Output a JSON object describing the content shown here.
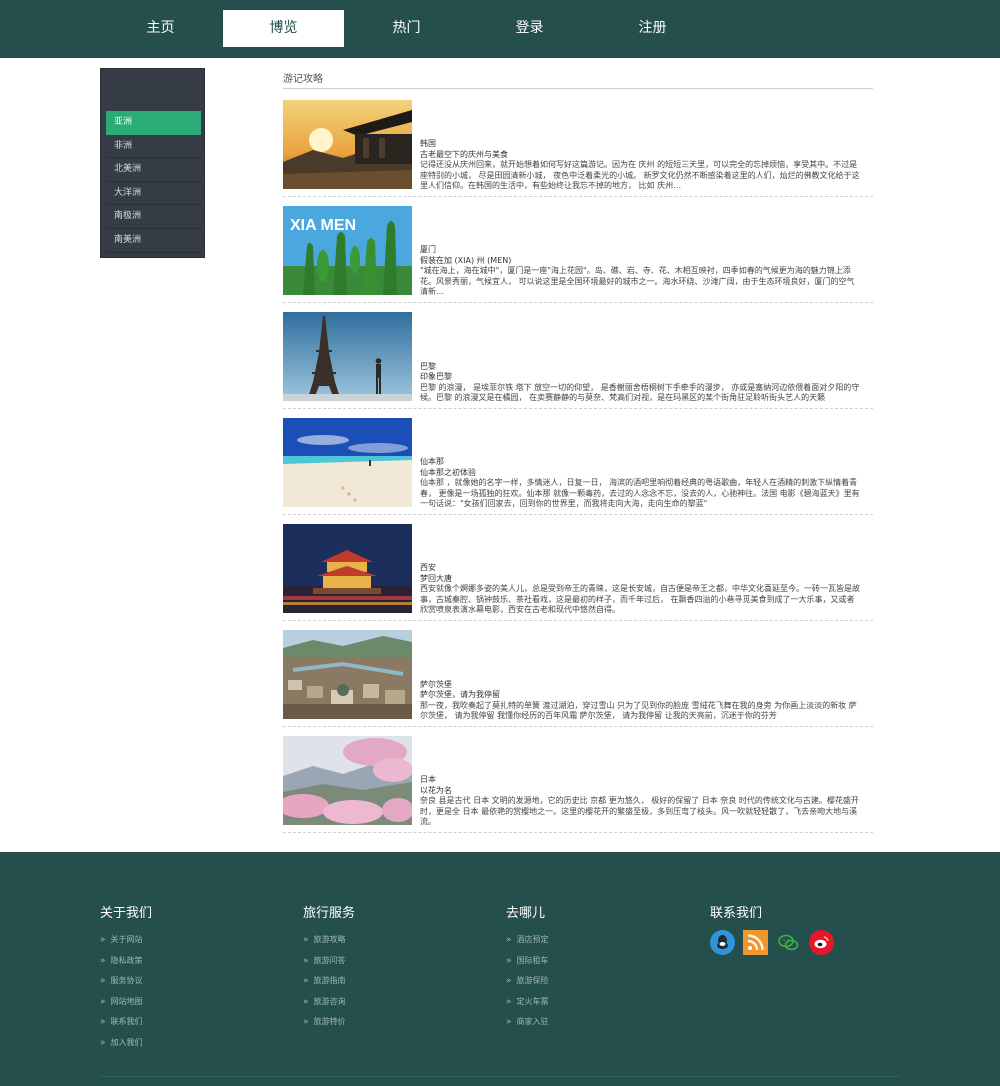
{
  "nav": {
    "items": [
      {
        "label": "主页",
        "active": false
      },
      {
        "label": "博览",
        "active": true
      },
      {
        "label": "热门",
        "active": false
      },
      {
        "label": "登录",
        "active": false
      },
      {
        "label": "注册",
        "active": false
      }
    ]
  },
  "sidebar": {
    "items": [
      {
        "label": "亚洲",
        "active": true
      },
      {
        "label": "非洲",
        "active": false
      },
      {
        "label": "北美洲",
        "active": false
      },
      {
        "label": "大洋洲",
        "active": false
      },
      {
        "label": "南极洲",
        "active": false
      },
      {
        "label": "南美洲",
        "active": false
      }
    ]
  },
  "main": {
    "section_title": "游记攻略",
    "articles": [
      {
        "location": "韩国",
        "subtitle": "古老最空下的庆州与美食",
        "description": "记得还没从庆州回来，就开始想着如何写好这篇游记。因为在 庆州 的短短三天里，可以完全的忘掉烦恼，享受其中。不过是座特别的小城， 尽是田园清新小城， 夜色中泛着柔光的小城。 新罗文化仍然不断感染着这里的人们，灿烂的佛教文化给于这里人们信仰。在韩国的生活中，有些始终让我忘不掉的地方， 比如 庆州…",
        "image_text": ""
      },
      {
        "location": "厦门",
        "subtitle": "假装在加 (XIA) 州 (MEN)",
        "description": "\"城在海上，海在城中\"，厦门是一座\"海上花园\"。岛、礁、岩、寺、花、木相互映衬，四季如春的气候更为海的魅力锦上添花。风景秀丽，气候宜人， 可以说这里是全国环境最好的城市之一。海水环绕、沙滩广阔，由于生态环境良好，厦门的空气清新…",
        "image_text": "XIA MEN"
      },
      {
        "location": "巴黎",
        "subtitle": "印象巴黎",
        "description": "巴黎 的浪漫， 是埃菲尔铁 塔下 放空一切的仰望， 是香榭丽舍梧桐树下手牵手的漫步， 亦或是塞纳河边依偎着面对夕阳的守候。巴黎 的浪漫又是在橘园， 在卖赛静静的与莫奈、梵高们对视，是在玛黑区的某个街角驻足聆听街头艺人的天籁",
        "image_text": ""
      },
      {
        "location": "仙本那",
        "subtitle": "仙本那之初体验",
        "description": "仙本那 ，就像她的名字一样，多情迷人，日复一日， 海滨的酒吧里响彻着经典的粤语歌曲，年轻人在酒精的刺激下纵情着青春， 更像是一场孤独的狂欢。仙本那 就像一颗毒药，去过的人念念不忘，没去的人，心驰神往。法国 电影《碧海蓝天》里有一句话说：\"女孩们回家去，回到你的世界里，而我将走向大海，走向生命的黎蓝\"",
        "image_text": ""
      },
      {
        "location": "西安",
        "subtitle": "梦回大唐",
        "description": "西安就像个婀娜多姿的美人儿，总是受到帝王的青睐，这是长安城，自古便是帝王之都，中华文化喜延至今。一砖一瓦皆是故事，古城秦腔、锅钟鼓乐、茶社看戏，这是最初的样子，而千年过后， 在飘香四溢的小巷寻觅美食到成了一大乐事，又或者欣赏喷泉表演水幕电影，西安在古老和现代中悠然自得。",
        "image_text": ""
      },
      {
        "location": "萨尔茨堡",
        "subtitle": "萨尔茨堡，请为我停留",
        "description": "那一夜，我吹奏起了莫扎特的单簧 渡过湖泊，穿过雪山 只为了见到你的脸庞 雪绒花飞舞在我的身旁 为你画上淡淡的新妆 萨尔茨堡， 请为我停留 我懂你经历的百年风霜 萨尔茨堡， 请为我停留 让我的天亮前，沉迷于你的芬芳",
        "image_text": ""
      },
      {
        "location": "日本",
        "subtitle": "以花为名",
        "description": "奈良 县是古代 日本 文明的发源地，它的历史比 京都 更为悠久， 极好的保留了 日本 奈良 时代的传统文化与古建。樱花盛开时，更是全 日本 最依艳的赏樱地之一。这里的樱花开的繁盛至极，多到压弯了枝头。风一吹就轻轻散了，飞去亲吻大地与溪流。",
        "image_text": ""
      }
    ]
  },
  "footer": {
    "columns": [
      {
        "title": "关于我们",
        "links": [
          "关于网站",
          "隐私政策",
          "服务协议",
          "网站地图",
          "联系我们",
          "加入我们"
        ]
      },
      {
        "title": "旅行服务",
        "links": [
          "旅游攻略",
          "旅游问答",
          "旅游指南",
          "旅游咨询",
          "旅游特价"
        ]
      },
      {
        "title": "去哪儿",
        "links": [
          "酒店预定",
          "国际租车",
          "旅游保险",
          "定火车票",
          "商家入驻"
        ]
      }
    ],
    "contact_title": "联系我们",
    "social": [
      {
        "icon": "qq-icon",
        "color": "#2f94d8"
      },
      {
        "icon": "rss-icon",
        "color": "#f0972c"
      },
      {
        "icon": "wechat-icon",
        "color": "#3bb247"
      },
      {
        "icon": "weibo-icon",
        "color": "#e6162d"
      }
    ]
  },
  "colors": {
    "brand": "#254f4d",
    "sidebar_bg": "#353c46",
    "sidebar_active": "#2aab77"
  }
}
